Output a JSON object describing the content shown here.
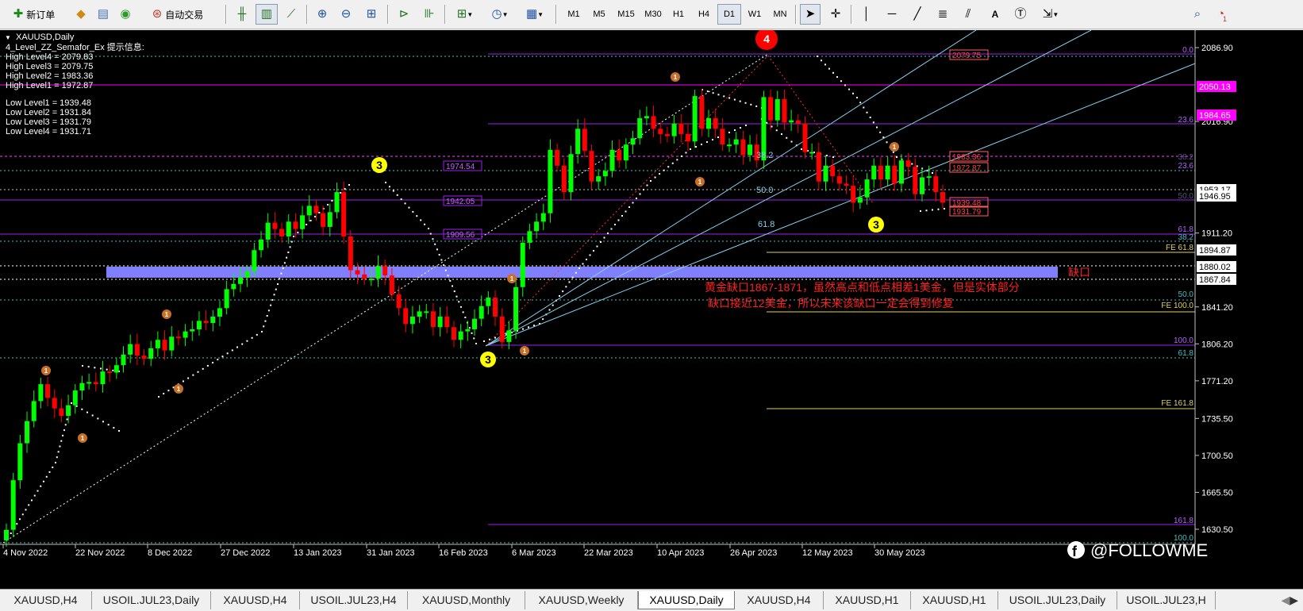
{
  "toolbar": {
    "new_order": "新订单",
    "auto_trading": "自动交易",
    "timeframes": [
      "M1",
      "M5",
      "M15",
      "M30",
      "H1",
      "H4",
      "D1",
      "W1",
      "MN"
    ],
    "active_timeframe": "D1",
    "text_tool": "A",
    "notification_count": "1"
  },
  "chart": {
    "symbol_label": "XAUUSD,Daily",
    "indicator_title": "4_Level_ZZ_Semafor_Ex 提示信息:",
    "high_levels": [
      "High Level4 = 2079.83",
      "High Level3 = 2079.75",
      "High Level2 = 1983.36",
      "High Level1 = 1972.87"
    ],
    "low_levels": [
      "Low Level1 = 1939.48",
      "Low Level2 = 1931.84",
      "Low Level3 = 1931.79",
      "Low Level4 = 1931.71"
    ],
    "price_ticks": [
      "2086.90",
      "2016.90",
      "1911.20",
      "1841.20",
      "1806.20",
      "1771.20",
      "1735.50",
      "1700.50",
      "1665.50",
      "1630.50"
    ],
    "date_ticks": [
      "4 Nov 2022",
      "22 Nov 2022",
      "8 Dec 2022",
      "27 Dec 2022",
      "13 Jan 2023",
      "31 Jan 2023",
      "16 Feb 2023",
      "6 Mar 2023",
      "22 Mar 2023",
      "10 Apr 2023",
      "26 Apr 2023",
      "12 May 2023",
      "30 May 2023"
    ],
    "price_markers": [
      {
        "label": "2050.13",
        "bg": "#ff00ff",
        "fg": "#ffffff"
      },
      {
        "label": "1984.65",
        "bg": "#ff00ff",
        "fg": "#ffffff"
      },
      {
        "label": "1953.17",
        "bg": "#ffffff",
        "fg": "#000000"
      },
      {
        "label": "1946.95",
        "bg": "#ffffff",
        "fg": "#000000"
      },
      {
        "label": "1894.87",
        "bg": "#ffffff",
        "fg": "#000000"
      },
      {
        "label": "1880.02",
        "bg": "#ffffff",
        "fg": "#000000"
      },
      {
        "label": "1867.84",
        "bg": "#ffffff",
        "fg": "#000000"
      }
    ],
    "fib_labels": [
      "0.0",
      "23.6",
      "23.6",
      "38.2",
      "50.0",
      "61.8",
      "38.2",
      "50.0",
      "100.0",
      "61.8",
      "161.8",
      "100.0"
    ],
    "fe_labels": [
      "FE 61.8",
      "FE 100.0",
      "FE 161.8"
    ],
    "fan_labels": [
      "38.2",
      "50.0",
      "61.8"
    ],
    "level_boxes": [
      "2079.75",
      "1974.54",
      "1942.05",
      "1909.56",
      "1983.36",
      "1972.87",
      "1939.48",
      "1931.79"
    ],
    "semafor_labels": [
      "4",
      "3",
      "3",
      "3",
      "1",
      "1",
      "1",
      "1",
      "1",
      "1",
      "1",
      "1",
      "1"
    ],
    "gap_label": "缺口",
    "annotation_line1": "黄金缺口1867-1871，虽然高点和低点相差1美金，但是实体部分",
    "annotation_line2": "缺口接近12美金，所以未来该缺口一定会得到修复",
    "watermark": "@FOLLOWME",
    "watermark_logo_letter": "f"
  },
  "tabs": [
    "XAUUSD,H4",
    "USOIL.JUL23,Daily",
    "XAUUSD,H4",
    "USOIL.JUL23,H4",
    "XAUUSD,Monthly",
    "XAUUSD,Weekly",
    "XAUUSD,Daily",
    "XAUUSD,H4",
    "XAUUSD,H1",
    "XAUUSD,H1",
    "USOIL.JUL23,Daily",
    "USOIL.JUL23,H"
  ],
  "active_tab": 6,
  "colors": {
    "bull": "#00ff00",
    "bear": "#ff0000",
    "fib": "#a020f0",
    "gap_band": "#8080ff",
    "fan": "#87ceeb",
    "annotation": "#ff2020",
    "semafor_yellow": "#ffff00",
    "semafor_red": "#ff0000",
    "semafor_orange": "#c87028"
  }
}
